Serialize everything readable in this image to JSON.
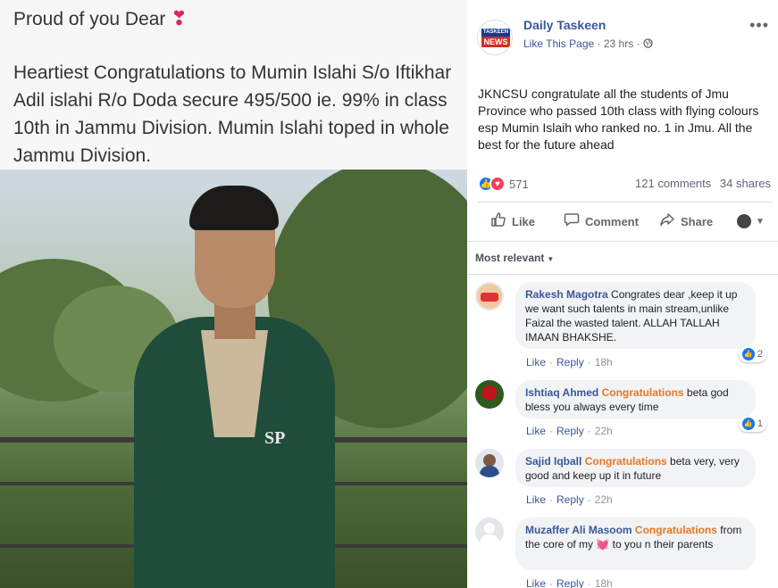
{
  "image_caption": {
    "heading": "Proud of you Dear",
    "heading_emoji": "heart-emoji",
    "body": "Heartiest Congratulations to Mumin Islahi S/o Iftikhar Adil islahi R/o Doda secure 495/500 ie. 99% in class 10th in Jammu Division. Mumin Islahi toped in whole Jammu Division."
  },
  "photo": {
    "jacket_badge": "SP"
  },
  "post": {
    "page_name": "Daily Taskeen",
    "avatar_top_text": "TASKEEN",
    "avatar_bottom_text": "NEWS",
    "like_page": "Like This Page",
    "time": "23 hrs",
    "privacy_icon": "globe-icon",
    "text": "JKNCSU congratulate all the students of Jmu Province who passed 10th class with flying colours esp Mumin Islaih who ranked no. 1 in Jmu. All the best for the future ahead",
    "reaction_count": "571",
    "comments_count": "121 comments",
    "shares_count": "34 shares"
  },
  "actions": {
    "like": "Like",
    "comment": "Comment",
    "share": "Share"
  },
  "sort": {
    "label": "Most relevant"
  },
  "comments": [
    {
      "author": "Rakesh Magotra",
      "highlight": "",
      "text": "Congrates dear ,keep it up we want such talents in main stream,unlike Faizal the wasted talent. ALLAH TALLAH IMAAN BHAKSHE.",
      "like": "Like",
      "reply": "Reply",
      "time": "18h",
      "reactions": "2"
    },
    {
      "author": "Ishtiaq Ahmed",
      "highlight": "Congratulations",
      "text": "beta god bless you always every time",
      "like": "Like",
      "reply": "Reply",
      "time": "22h",
      "reactions": "1"
    },
    {
      "author": "Sajid Iqball",
      "highlight": "Congratulations",
      "text": "beta very, very good and keep up it in future",
      "like": "Like",
      "reply": "Reply",
      "time": "22h",
      "reactions": ""
    },
    {
      "author": "Muzaffer Ali Masoom",
      "highlight": "Congratulations",
      "text_before": "from the core of my",
      "text_after": "to you n their parents",
      "like": "Like",
      "reply": "Reply",
      "time": "18h",
      "reactions": ""
    }
  ],
  "colors": {
    "link_blue": "#385898",
    "highlight_orange": "#e57722",
    "like_blue": "#1877f2",
    "love_red": "#f33e58"
  }
}
